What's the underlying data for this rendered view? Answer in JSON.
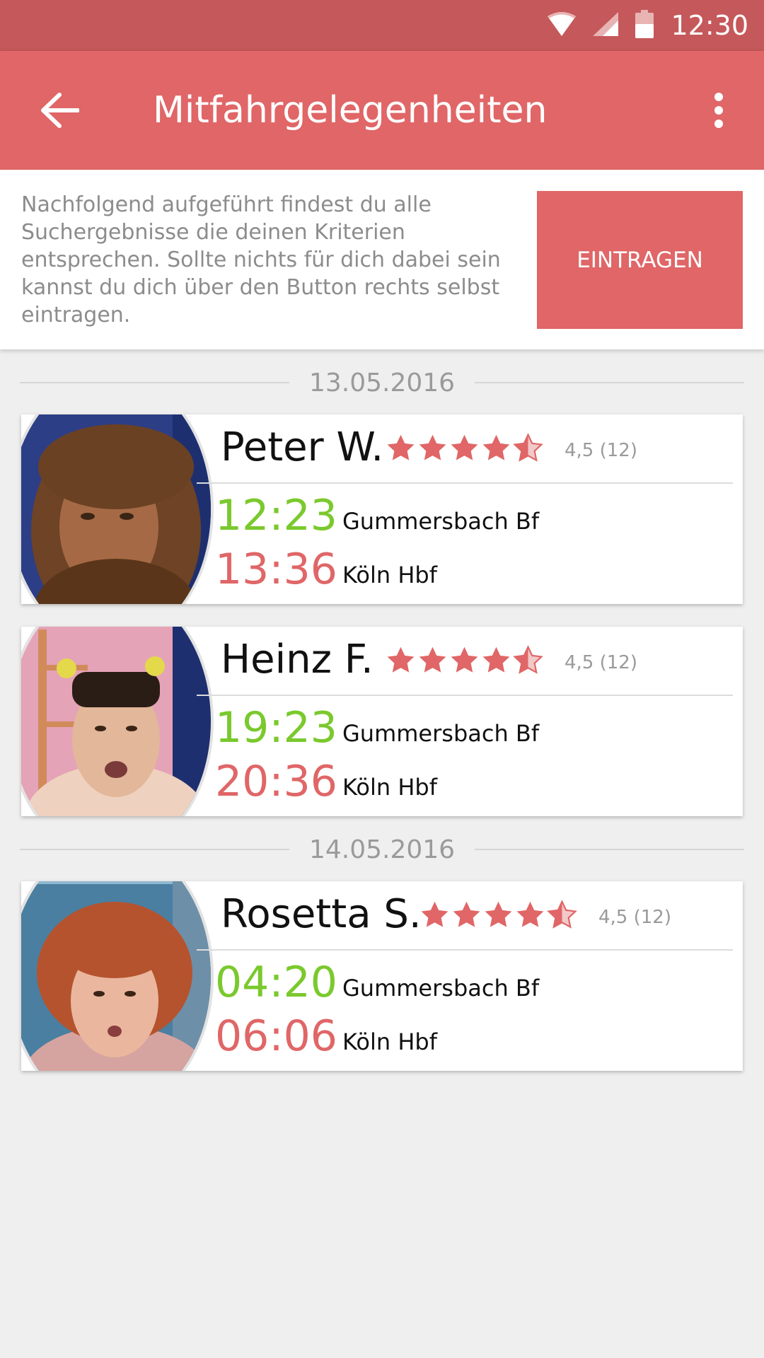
{
  "status_bar": {
    "time": "12:30"
  },
  "app_bar": {
    "title": "Mitfahrgelegenheiten"
  },
  "intro": {
    "text": "Nachfolgend aufgeführt findest du alle Suchergebnisse die deinen Kriterien entsprechen. Sollte nichts für dich dabei sein kannst du dich über den Button rechts selbst eintragen.",
    "button_label": "EINTRAGEN"
  },
  "groups": [
    {
      "date": "13.05.2016",
      "rides": [
        {
          "name": "Peter W.",
          "rating_value": 4.5,
          "rating": "4,5 (12)",
          "departure_time": "12:23",
          "departure_station": "Gummersbach Bf",
          "arrival_time": "13:36",
          "arrival_station": "Köln Hbf"
        },
        {
          "name": "Heinz F.",
          "rating_value": 4.5,
          "rating": "4,5 (12)",
          "departure_time": "19:23",
          "departure_station": "Gummersbach Bf",
          "arrival_time": "20:36",
          "arrival_station": "Köln Hbf"
        }
      ]
    },
    {
      "date": "14.05.2016",
      "rides": [
        {
          "name": "Rosetta S.",
          "rating_value": 4.5,
          "rating": "4,5 (12)",
          "departure_time": "04:20",
          "departure_station": "Gummersbach Bf",
          "arrival_time": "06:06",
          "arrival_station": "Köln Hbf"
        }
      ]
    }
  ],
  "colors": {
    "primary": "#e06667",
    "status_bar": "#c5585a",
    "departure_time": "#7ac92d",
    "arrival_time": "#e06667",
    "star": "#e06667"
  }
}
